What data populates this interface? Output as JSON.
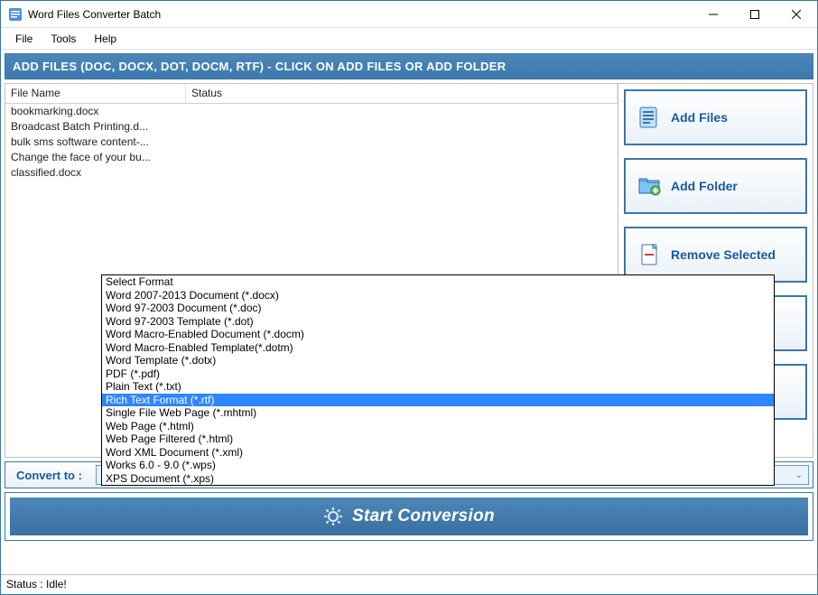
{
  "window": {
    "title": "Word Files Converter Batch"
  },
  "menu": {
    "file": "File",
    "tools": "Tools",
    "help": "Help"
  },
  "banner": "ADD FILES (DOC, DOCX, DOT, DOCM, RTF) - CLICK ON ADD FILES OR ADD FOLDER",
  "table": {
    "headers": {
      "filename": "File Name",
      "status": "Status"
    },
    "rows": [
      "bookmarking.docx",
      "Broadcast Batch Printing.d...",
      "bulk sms software content-...",
      "Change the face of your bu...",
      "classified.docx"
    ]
  },
  "sideButtons": {
    "addFiles": "Add Files",
    "addFolder": "Add Folder",
    "removeSelected": "Remove Selected"
  },
  "convert": {
    "label": "Convert to :",
    "selected": "Select Format",
    "options": [
      "Select Format",
      "Word 2007-2013 Document (*.docx)",
      "Word 97-2003 Document (*.doc)",
      "Word 97-2003 Template (*.dot)",
      "Word Macro-Enabled Document (*.docm)",
      "Word Macro-Enabled Template(*.dotm)",
      "Word Template (*.dotx)",
      "PDF (*.pdf)",
      "Plain Text (*.txt)",
      "Rich Text Format (*.rtf)",
      "Single File Web Page (*.mhtml)",
      "Web Page (*.html)",
      "Web Page Filtered (*.html)",
      "Word XML Document (*.xml)",
      "Works 6.0 - 9.0 (*.wps)",
      "XPS Document (*.xps)"
    ],
    "highlighted": "Rich Text Format (*.rtf)"
  },
  "start": "Start Conversion",
  "status": "Status  :  Idle!"
}
